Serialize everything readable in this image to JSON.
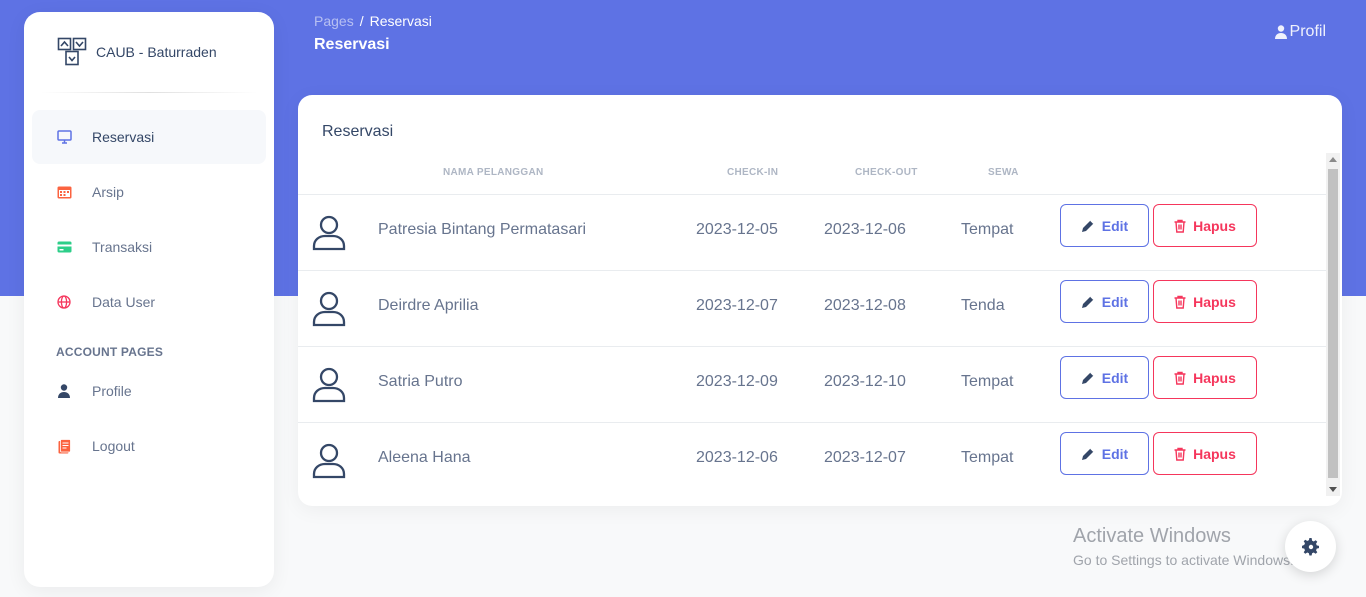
{
  "brand": {
    "name": "CAUB - Baturraden"
  },
  "sidebar": {
    "items": [
      {
        "label": "Reservasi",
        "icon": "monitor-icon",
        "color": "#5e72e4",
        "active": true
      },
      {
        "label": "Arsip",
        "icon": "calendar-icon",
        "color": "#fb6340"
      },
      {
        "label": "Transaksi",
        "icon": "credit-card-icon",
        "color": "#2dce89"
      },
      {
        "label": "Data User",
        "icon": "globe-icon",
        "color": "#f5365c"
      }
    ],
    "section_title": "ACCOUNT PAGES",
    "account_items": [
      {
        "label": "Profile",
        "icon": "user-icon",
        "color": "#344767"
      },
      {
        "label": "Logout",
        "icon": "document-icon",
        "color": "#fb6340"
      }
    ]
  },
  "header": {
    "breadcrumb_root": "Pages",
    "breadcrumb_sep": "/",
    "breadcrumb_current": "Reservasi",
    "title": "Reservasi",
    "profile_label": "Profil"
  },
  "card": {
    "title": "Reservasi",
    "columns": [
      "NAMA PELANGGAN",
      "CHECK-IN",
      "CHECK-OUT",
      "SEWA"
    ],
    "rows": [
      {
        "name": "Patresia Bintang Permatasari",
        "checkin": "2023-12-05",
        "checkout": "2023-12-06",
        "sewa": "Tempat"
      },
      {
        "name": "Deirdre Aprilia",
        "checkin": "2023-12-07",
        "checkout": "2023-12-08",
        "sewa": "Tenda"
      },
      {
        "name": "Satria Putro",
        "checkin": "2023-12-09",
        "checkout": "2023-12-10",
        "sewa": "Tempat"
      },
      {
        "name": "Aleena Hana",
        "checkin": "2023-12-06",
        "checkout": "2023-12-07",
        "sewa": "Tempat"
      }
    ],
    "edit_label": "Edit",
    "delete_label": "Hapus"
  },
  "watermark": {
    "title": "Activate Windows",
    "subtitle": "Go to Settings to activate Windows."
  },
  "colors": {
    "primary": "#5e72e4",
    "danger": "#f5365c",
    "warning": "#fb6340",
    "success": "#2dce89",
    "text": "#344767"
  }
}
